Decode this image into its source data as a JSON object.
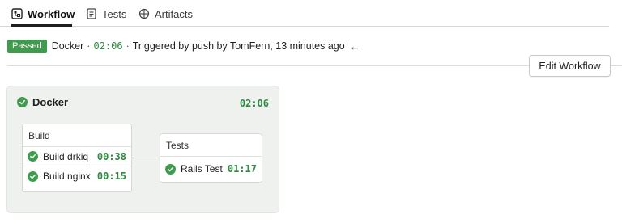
{
  "tabs": [
    {
      "label": "Workflow",
      "icon": "workflow-icon",
      "active": true
    },
    {
      "label": "Tests",
      "icon": "tests-icon",
      "active": false
    },
    {
      "label": "Artifacts",
      "icon": "artifacts-icon",
      "active": false
    }
  ],
  "status": {
    "badge": "Passed",
    "pipeline_name": "Docker",
    "sep1": "·",
    "duration": "02:06",
    "sep2": "·",
    "trigger_text": "Triggered by push by TomFern, 13 minutes ago",
    "back_arrow": "←"
  },
  "toolbar": {
    "edit_label": "Edit Workflow"
  },
  "pipeline": {
    "name": "Docker",
    "duration": "02:06",
    "blocks": [
      {
        "title": "Build",
        "jobs": [
          {
            "label": "Build drkiq",
            "time": "00:38"
          },
          {
            "label": "Build nginx",
            "time": "00:15"
          }
        ]
      },
      {
        "title": "Tests",
        "jobs": [
          {
            "label": "Rails Test",
            "time": "01:17"
          }
        ]
      }
    ]
  },
  "colors": {
    "success": "#3f9b4d",
    "time_green": "#2e8b3f",
    "pipeline_bg": "#eef1ee"
  }
}
